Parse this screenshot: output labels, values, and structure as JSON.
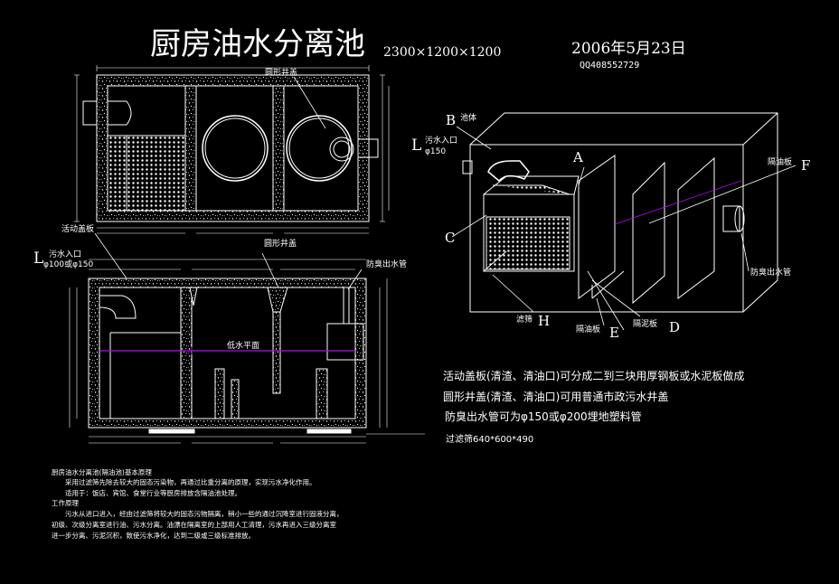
{
  "title": "厨房油水分离池",
  "dims": "2300×1200×1200",
  "date": "2006年5月23日",
  "qq": "QQ408552729",
  "top_view": {
    "round_cover_label": "圆形井盖"
  },
  "section_view": {
    "movable_cover_label": "活动盖板",
    "round_cover_label": "圆形井盖",
    "inlet_letter": "L",
    "inlet_label": "污水入口",
    "inlet_spec": "φ100或φ150",
    "outlet_label": "防臭出水管",
    "water_level_label": "低水平面"
  },
  "iso_view": {
    "letters": {
      "A": "A",
      "B": "B",
      "C": "C",
      "D": "D",
      "E": "E",
      "F": "F",
      "H": "H",
      "L": "L"
    },
    "body_label": "池体",
    "inlet_label": "污水入口",
    "inlet_spec": "φ150",
    "baffle_label_f": "隔油板",
    "outlet_label": "防臭出水管",
    "filter_label": "滤筛",
    "baffle_label_e": "隔油板",
    "baffle_label_d": "隔泥板"
  },
  "notes": [
    "活动盖板(清渣、清油口)可分成二到三块用厚钢板或水泥板做成",
    "圆形井盖(清渣、清油口)可用普通市政污水井盖",
    "防臭出水管可为φ150或φ200埋地塑料管",
    "过滤筛640*600*490"
  ],
  "description": [
    "厨房油水分离池(隔油池)基本原理",
    "采用过滤筛先除去较大的固态污染物，再通过比重分离的原理，实现污水净化作用。",
    "适用于：饭店、宾馆、食堂行业等厨房排放含隔油池处理。",
    "工作原理",
    "污水从进口进入，经由过滤筛将较大的固态污物隔离，稍小一些的通过沉降室进行固液分离，",
    "初级、次级分离室进行油、污水分离。油漂在隔离室的上部用人工清理，污水再进入三级分离室",
    "进一步分离、污泥沉积，致使污水净化，达到二级或三级标准排放。"
  ]
}
